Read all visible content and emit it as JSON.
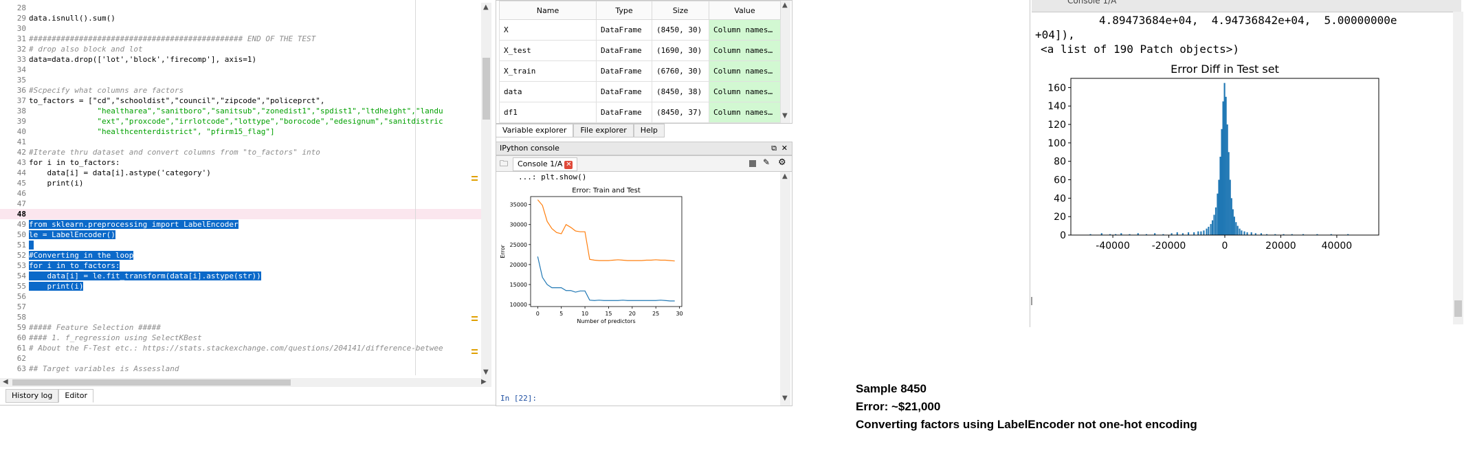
{
  "editor": {
    "current_line": "48",
    "lines": [
      {
        "n": "28",
        "text": ""
      },
      {
        "n": "29",
        "text": "data.isnull().sum()"
      },
      {
        "n": "30",
        "text": ""
      },
      {
        "n": "31",
        "text": "############################################### END OF THE TEST",
        "style": "comment"
      },
      {
        "n": "32",
        "text": "# drop also block and lot",
        "style": "comment"
      },
      {
        "n": "33",
        "text": "data=data.drop(['lot','block','firecomp'], axis=1)"
      },
      {
        "n": "34",
        "text": ""
      },
      {
        "n": "35",
        "text": ""
      },
      {
        "n": "36",
        "text": "#Scpecify what columns are factors",
        "style": "comment"
      },
      {
        "n": "37",
        "text": "to_factors = [\"cd\",\"schooldist\",\"council\",\"zipcode\",\"policeprct\","
      },
      {
        "n": "38",
        "text": "               \"healtharea\",\"sanitboro\",\"sanitsub\",\"zonedist1\",\"spdist1\",\"ltdheight\",\"landu",
        "style": "str"
      },
      {
        "n": "39",
        "text": "               \"ext\",\"proxcode\",\"irrlotcode\",\"lottype\",\"borocode\",\"edesignum\",\"sanitdistric",
        "style": "str"
      },
      {
        "n": "40",
        "text": "               \"healthcenterdistrict\", \"pfirm15_flag\"]",
        "style": "str"
      },
      {
        "n": "41",
        "text": ""
      },
      {
        "n": "42",
        "text": "#Iterate thru dataset and convert columns from \"to_factors\" into",
        "style": "comment"
      },
      {
        "n": "43",
        "text": "for i in to_factors:"
      },
      {
        "n": "44",
        "text": "    data[i] = data[i].astype('category')"
      },
      {
        "n": "45",
        "text": "    print(i)"
      },
      {
        "n": "46",
        "text": ""
      },
      {
        "n": "47",
        "text": ""
      },
      {
        "n": "48",
        "text": "",
        "style": "cursor"
      },
      {
        "n": "49",
        "text": "from sklearn.preprocessing import LabelEncoder",
        "style": "hl"
      },
      {
        "n": "50",
        "text": "le = LabelEncoder()",
        "style": "hl"
      },
      {
        "n": "51",
        "text": " ",
        "style": "hl"
      },
      {
        "n": "52",
        "text": "#Converting in the loop",
        "style": "hl"
      },
      {
        "n": "53",
        "text": "for i in to_factors:",
        "style": "hl"
      },
      {
        "n": "54",
        "text": "    data[i] = le.fit_transform(data[i].astype(str))",
        "style": "hl"
      },
      {
        "n": "55",
        "text": "    print(i)",
        "style": "hl"
      },
      {
        "n": "56",
        "text": ""
      },
      {
        "n": "57",
        "text": ""
      },
      {
        "n": "58",
        "text": ""
      },
      {
        "n": "59",
        "text": "##### Feature Selection #####",
        "style": "comment"
      },
      {
        "n": "60",
        "text": "#### 1. f_regression using SelectKBest",
        "style": "comment"
      },
      {
        "n": "61",
        "text": "# About the F-Test etc.: https://stats.stackexchange.com/questions/204141/difference-betwee",
        "style": "comment"
      },
      {
        "n": "62",
        "text": ""
      },
      {
        "n": "63",
        "text": "## Target variables is Assessland",
        "style": "comment"
      }
    ],
    "bottom_tabs": [
      "History log",
      "Editor"
    ]
  },
  "variable_explorer": {
    "headers": [
      "Name",
      "Type",
      "Size",
      "Value"
    ],
    "rows": [
      [
        "X",
        "DataFrame",
        "(8450, 30)",
        "Column names…"
      ],
      [
        "X_test",
        "DataFrame",
        "(1690, 30)",
        "Column names…"
      ],
      [
        "X_train",
        "DataFrame",
        "(6760, 30)",
        "Column names…"
      ],
      [
        "data",
        "DataFrame",
        "(8450, 38)",
        "Column names…"
      ],
      [
        "df1",
        "DataFrame",
        "(8450, 37)",
        "Column names…"
      ]
    ],
    "tabs": [
      "Variable explorer",
      "File explorer",
      "Help"
    ]
  },
  "ipython_console": {
    "title": "IPython console",
    "tab_label": "Console 1/A",
    "continuation": "...: plt.show()",
    "prompt": "In [22]:"
  },
  "right_console": {
    "tab_label": "Console 1/A",
    "line1": "4.89473684e+04,  4.94736842e+04,  5.00000000e",
    "line2": "+04]),",
    "line3": "<a list of 190 Patch objects>)"
  },
  "chart_data": [
    {
      "type": "line",
      "title": "Error: Train and Test",
      "xlabel": "Number of predictors",
      "ylabel": "Error",
      "xlim": [
        -1.5,
        30.5
      ],
      "ylim": [
        9500,
        37000
      ],
      "xticks": [
        0,
        5,
        10,
        15,
        20,
        25,
        30
      ],
      "yticks": [
        10000,
        15000,
        20000,
        25000,
        30000,
        35000
      ],
      "x": [
        0,
        1,
        2,
        3,
        4,
        5,
        6,
        7,
        8,
        9,
        10,
        11,
        12,
        13,
        14,
        15,
        16,
        17,
        18,
        19,
        20,
        21,
        22,
        23,
        24,
        25,
        26,
        27,
        28,
        29
      ],
      "series": [
        {
          "color": "#ff7f0e",
          "values": [
            36200,
            34800,
            30800,
            29000,
            28000,
            27700,
            30000,
            29300,
            28400,
            28200,
            28200,
            21300,
            21100,
            21000,
            21000,
            21000,
            21100,
            21200,
            21100,
            21000,
            21000,
            21000,
            21000,
            21100,
            21100,
            21200,
            21100,
            21100,
            21000,
            20900
          ]
        },
        {
          "color": "#1f77b4",
          "values": [
            22000,
            16800,
            15000,
            14200,
            14200,
            14200,
            13500,
            13500,
            13100,
            13400,
            13400,
            11100,
            11000,
            11100,
            11000,
            11000,
            11000,
            11000,
            11100,
            11000,
            11000,
            11000,
            11000,
            11000,
            11000,
            11000,
            11100,
            11000,
            10900,
            10900
          ]
        }
      ]
    },
    {
      "type": "bar",
      "title": "Error Diff in Test set",
      "xlim": [
        -55000,
        55000
      ],
      "ylim": [
        0,
        170
      ],
      "xticks": [
        -40000,
        -20000,
        0,
        20000,
        40000
      ],
      "yticks": [
        0,
        20,
        40,
        60,
        80,
        100,
        120,
        140,
        160
      ],
      "color": "#1f77b4",
      "bin_width": 526.3,
      "bins": [
        {
          "x": -48000,
          "y": 1
        },
        {
          "x": -44000,
          "y": 2
        },
        {
          "x": -41000,
          "y": 1
        },
        {
          "x": -39000,
          "y": 1
        },
        {
          "x": -37000,
          "y": 2
        },
        {
          "x": -34000,
          "y": 1
        },
        {
          "x": -31000,
          "y": 2
        },
        {
          "x": -28000,
          "y": 1
        },
        {
          "x": -25000,
          "y": 2
        },
        {
          "x": -22000,
          "y": 1
        },
        {
          "x": -19000,
          "y": 2
        },
        {
          "x": -17000,
          "y": 3
        },
        {
          "x": -15000,
          "y": 2
        },
        {
          "x": -13000,
          "y": 3
        },
        {
          "x": -11000,
          "y": 3
        },
        {
          "x": -9500,
          "y": 4
        },
        {
          "x": -8500,
          "y": 4
        },
        {
          "x": -7500,
          "y": 5
        },
        {
          "x": -6500,
          "y": 7
        },
        {
          "x": -5800,
          "y": 9
        },
        {
          "x": -5000,
          "y": 12
        },
        {
          "x": -4400,
          "y": 16
        },
        {
          "x": -3800,
          "y": 22
        },
        {
          "x": -3200,
          "y": 30
        },
        {
          "x": -2600,
          "y": 45
        },
        {
          "x": -2100,
          "y": 60
        },
        {
          "x": -1600,
          "y": 85
        },
        {
          "x": -1100,
          "y": 115
        },
        {
          "x": -600,
          "y": 145
        },
        {
          "x": -100,
          "y": 165
        },
        {
          "x": 400,
          "y": 150
        },
        {
          "x": 900,
          "y": 120
        },
        {
          "x": 1400,
          "y": 90
        },
        {
          "x": 1900,
          "y": 60
        },
        {
          "x": 2400,
          "y": 40
        },
        {
          "x": 2900,
          "y": 28
        },
        {
          "x": 3400,
          "y": 20
        },
        {
          "x": 4000,
          "y": 14
        },
        {
          "x": 4600,
          "y": 10
        },
        {
          "x": 5300,
          "y": 7
        },
        {
          "x": 6000,
          "y": 5
        },
        {
          "x": 7000,
          "y": 4
        },
        {
          "x": 8000,
          "y": 3
        },
        {
          "x": 9500,
          "y": 3
        },
        {
          "x": 11000,
          "y": 2
        },
        {
          "x": 13000,
          "y": 2
        },
        {
          "x": 15000,
          "y": 1
        },
        {
          "x": 18000,
          "y": 1
        },
        {
          "x": 21000,
          "y": 1
        },
        {
          "x": 24000,
          "y": 1
        },
        {
          "x": 28000,
          "y": 1
        },
        {
          "x": 33000,
          "y": 1
        },
        {
          "x": 38000,
          "y": 1
        },
        {
          "x": 44000,
          "y": 1
        }
      ]
    }
  ],
  "notes": {
    "line1": "Sample 8450",
    "line2": "Error: ~$21,000",
    "line3": "Converting factors using LabelEncoder not one-hot encoding"
  }
}
